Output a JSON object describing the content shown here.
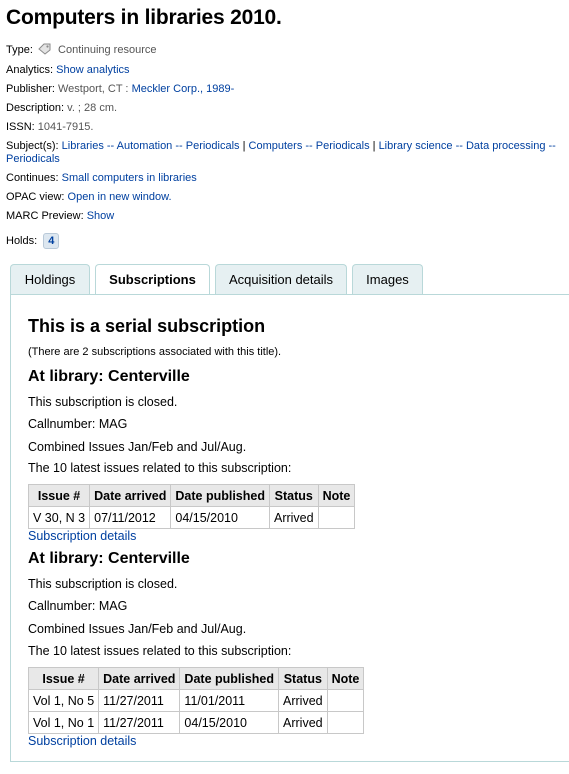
{
  "title": "Computers in libraries 2010.",
  "meta": {
    "type_label": "Type:",
    "type_value": "Continuing resource",
    "type_icon": "tag-icon",
    "analytics_label": "Analytics:",
    "analytics_link": "Show analytics",
    "publisher_label": "Publisher:",
    "publisher_place": "Westport, CT :",
    "publisher_link": "Meckler Corp., 1989-",
    "description_label": "Description:",
    "description_value": "v. ; 28 cm.",
    "issn_label": "ISSN:",
    "issn_value": "1041-7915.",
    "subjects_label": "Subject(s):",
    "subjects": [
      "Libraries -- Automation -- Periodicals",
      "Computers -- Periodicals",
      "Library science -- Data processing -- Periodicals"
    ],
    "subject_separator": " | ",
    "continues_label": "Continues:",
    "continues_link": "Small computers in libraries",
    "opac_label": "OPAC view:",
    "opac_link": "Open in new window.",
    "marc_label": "MARC Preview:",
    "marc_link": "Show",
    "holds_label": "Holds:",
    "holds_count": "4"
  },
  "tabs": [
    {
      "label": "Holdings",
      "active": false
    },
    {
      "label": "Subscriptions",
      "active": true
    },
    {
      "label": "Acquisition details",
      "active": false
    },
    {
      "label": "Images",
      "active": false
    }
  ],
  "subscriptions": {
    "heading": "This is a serial subscription",
    "count_note": "(There are 2 subscriptions associated with this title).",
    "columns": [
      "Issue #",
      "Date arrived",
      "Date published",
      "Status",
      "Note"
    ],
    "items": [
      {
        "library": "At library: Centerville",
        "closed": "This subscription is closed.",
        "callnumber": "Callnumber: MAG",
        "combined": "Combined Issues Jan/Feb and Jul/Aug.",
        "latest": "The 10 latest issues related to this subscription:",
        "rows": [
          [
            "V 30, N 3",
            "07/11/2012",
            "04/15/2010",
            "Arrived",
            ""
          ]
        ],
        "details_link": "Subscription details"
      },
      {
        "library": "At library: Centerville",
        "closed": "This subscription is closed.",
        "callnumber": "Callnumber: MAG",
        "combined": "Combined Issues Jan/Feb and Jul/Aug.",
        "latest": "The 10 latest issues related to this subscription:",
        "rows": [
          [
            "Vol 1, No 5",
            "11/27/2011",
            "11/01/2011",
            "Arrived",
            ""
          ],
          [
            "Vol 1, No 1",
            "11/27/2011",
            "04/15/2010",
            "Arrived",
            ""
          ]
        ],
        "details_link": "Subscription details"
      }
    ]
  }
}
